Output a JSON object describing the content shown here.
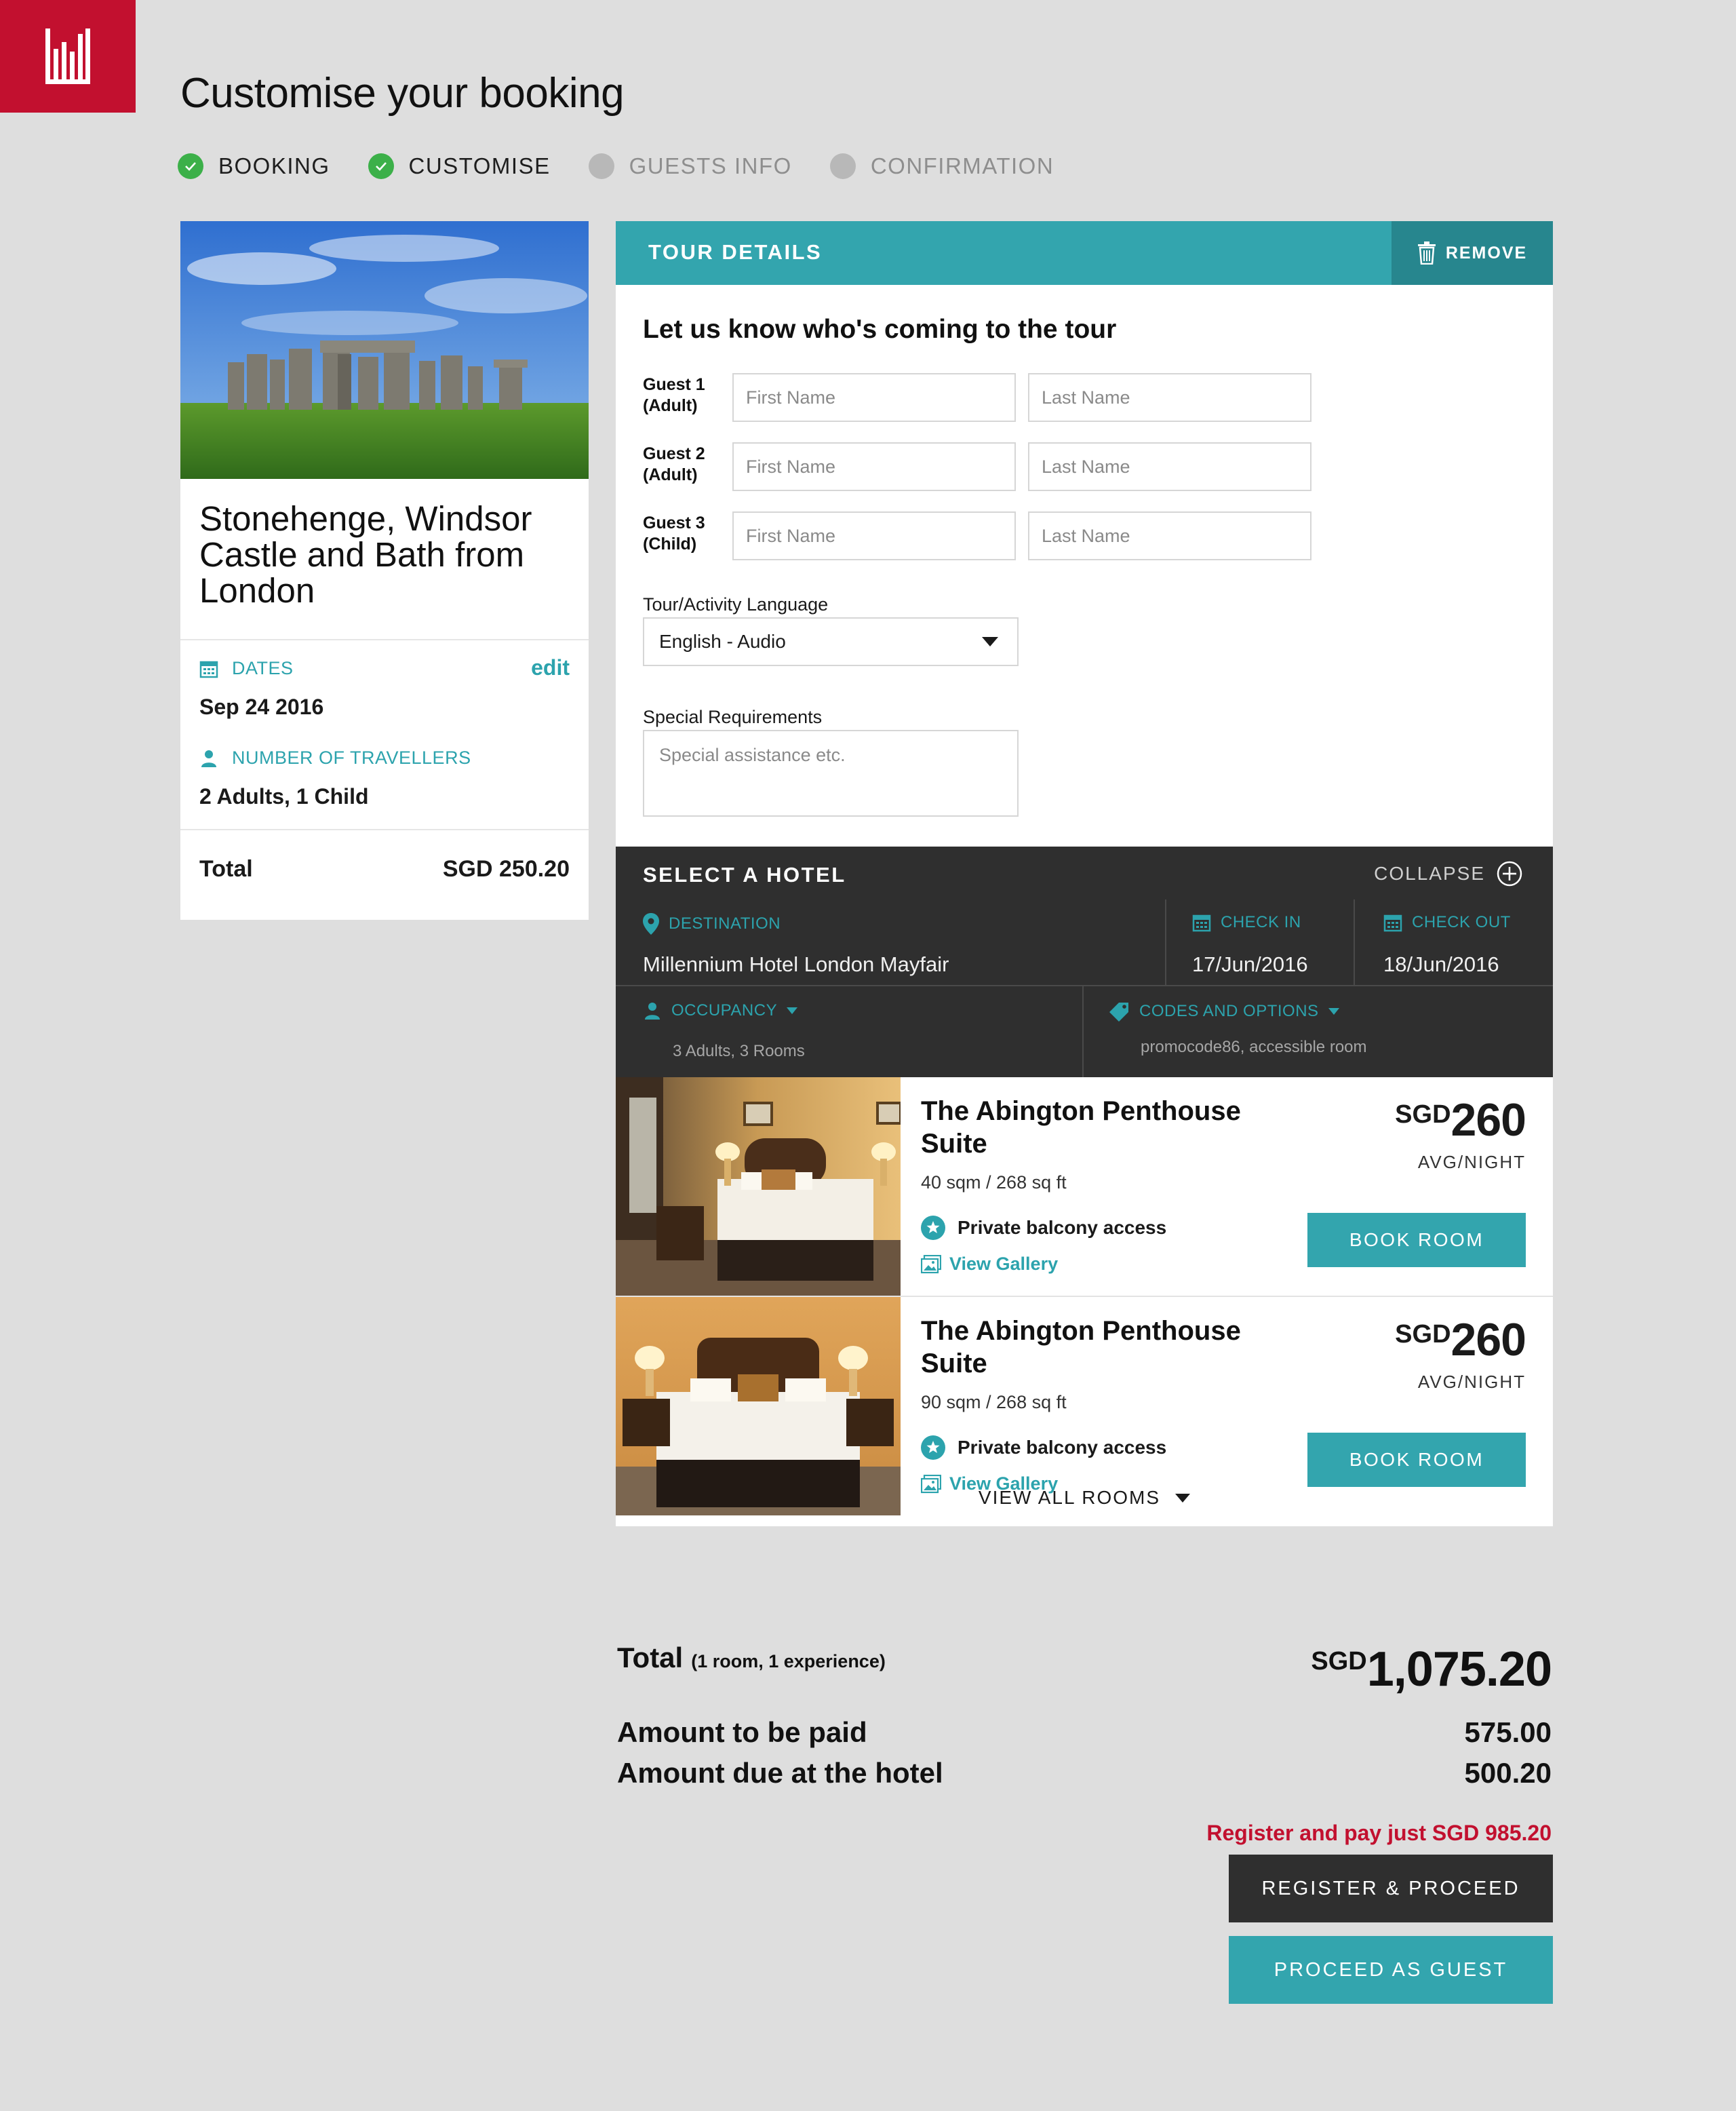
{
  "page": {
    "title": "Customise your booking"
  },
  "steps": [
    {
      "label": "BOOKING",
      "status": "done"
    },
    {
      "label": "CUSTOMISE",
      "status": "done"
    },
    {
      "label": "GUESTS INFO",
      "status": "todo"
    },
    {
      "label": "CONFIRMATION",
      "status": "todo"
    }
  ],
  "tour_card": {
    "title": "Stonehenge, Windsor Castle and Bath from London",
    "dates_label": "DATES",
    "edit_label": "edit",
    "dates_value": "Sep 24 2016",
    "travellers_label": "NUMBER OF TRAVELLERS",
    "travellers_value": "2 Adults, 1 Child",
    "total_label": "Total",
    "total_value": "SGD 250.20"
  },
  "tour_details": {
    "header": "TOUR DETAILS",
    "remove_label": "REMOVE",
    "subtitle": "Let us know who's coming to the tour",
    "guests": [
      {
        "line1": "Guest 1",
        "line2": "(Adult)",
        "first_placeholder": "First Name",
        "last_placeholder": "Last Name"
      },
      {
        "line1": "Guest 2",
        "line2": "(Adult)",
        "first_placeholder": "First Name",
        "last_placeholder": "Last Name"
      },
      {
        "line1": "Guest 3",
        "line2": "(Child)",
        "first_placeholder": "First Name",
        "last_placeholder": "Last Name"
      }
    ],
    "language_label": "Tour/Activity Language",
    "language_value": "English - Audio",
    "requirements_label": "Special Requirements",
    "requirements_placeholder": "Special assistance etc."
  },
  "hotel": {
    "header": "SELECT A HOTEL",
    "collapse_label": "COLLAPSE",
    "destination_label": "DESTINATION",
    "destination_value": "Millennium Hotel London Mayfair",
    "checkin_label": "CHECK IN",
    "checkin_value": "17/Jun/2016",
    "checkout_label": "CHECK OUT",
    "checkout_value": "18/Jun/2016",
    "occupancy_label": "OCCUPANCY",
    "occupancy_value": "3 Adults, 3 Rooms",
    "codes_label": "CODES AND OPTIONS",
    "codes_value": "promocode86, accessible room"
  },
  "rooms": [
    {
      "name": "The Abington Penthouse Suite",
      "size": "40 sqm / 268 sq ft",
      "feature": "Private balcony access",
      "gallery": "View Gallery",
      "currency": "SGD",
      "price": "260",
      "per": "AVG/NIGHT",
      "button": "BOOK ROOM"
    },
    {
      "name": "The Abington Penthouse Suite",
      "size": "90 sqm / 268 sq ft",
      "feature": "Private balcony access",
      "gallery": "View Gallery",
      "currency": "SGD",
      "price": "260",
      "per": "AVG/NIGHT",
      "button": "BOOK ROOM"
    }
  ],
  "view_all_label": "VIEW ALL ROOMS",
  "totals": {
    "total_label": "Total",
    "total_note": "(1 room, 1 experience)",
    "total_currency": "SGD",
    "total_value": "1,075.20",
    "paid_label": "Amount to be paid",
    "paid_value": "575.00",
    "due_label": "Amount due at the hotel",
    "due_value": "500.20",
    "register_note": "Register and pay just SGD 985.20",
    "register_button": "REGISTER & PROCEED",
    "guest_button": "PROCEED AS GUEST"
  },
  "colors": {
    "brand": "#c2102f",
    "accent": "#33a5ae",
    "dark": "#2f2f2f",
    "success": "#3cb049"
  }
}
